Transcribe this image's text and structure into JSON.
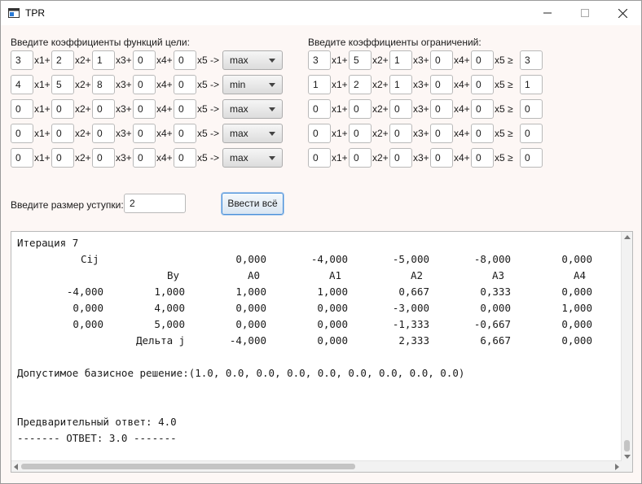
{
  "window": {
    "title": "TPR"
  },
  "goals": {
    "label": "Введите коэффициенты функций цели:",
    "var_labels": [
      "x1+",
      "x2+",
      "x3+",
      "x4+",
      "x5 ->"
    ],
    "rows": [
      {
        "coeffs": [
          "3",
          "2",
          "1",
          "0",
          "0"
        ],
        "direction": "max"
      },
      {
        "coeffs": [
          "4",
          "5",
          "8",
          "0",
          "0"
        ],
        "direction": "min"
      },
      {
        "coeffs": [
          "0",
          "0",
          "0",
          "0",
          "0"
        ],
        "direction": "max"
      },
      {
        "coeffs": [
          "0",
          "0",
          "0",
          "0",
          "0"
        ],
        "direction": "max"
      },
      {
        "coeffs": [
          "0",
          "0",
          "0",
          "0",
          "0"
        ],
        "direction": "max"
      }
    ]
  },
  "constraints": {
    "label": "Введите коэффициенты ограничений:",
    "var_labels": [
      "x1+",
      "x2+",
      "x3+",
      "x4+",
      "x5 ≥"
    ],
    "rows": [
      {
        "coeffs": [
          "3",
          "5",
          "1",
          "0",
          "0"
        ],
        "rhs": "3"
      },
      {
        "coeffs": [
          "1",
          "2",
          "1",
          "0",
          "0"
        ],
        "rhs": "1"
      },
      {
        "coeffs": [
          "0",
          "0",
          "0",
          "0",
          "0"
        ],
        "rhs": "0"
      },
      {
        "coeffs": [
          "0",
          "0",
          "0",
          "0",
          "0"
        ],
        "rhs": "0"
      },
      {
        "coeffs": [
          "0",
          "0",
          "0",
          "0",
          "0"
        ],
        "rhs": "0"
      }
    ]
  },
  "step": {
    "label": "Введите размер уступки:",
    "value": "2",
    "button": "Ввести всё"
  },
  "output": {
    "iteration": "Итерация 7",
    "cij_label": "Cij",
    "cij_values": [
      "0,000",
      "-4,000",
      "-5,000",
      "-8,000",
      "0,000"
    ],
    "by_label": "By",
    "columns": [
      "A0",
      "A1",
      "A2",
      "A3",
      "A4"
    ],
    "rows": [
      {
        "basis": "-4,000",
        "by": "1,000",
        "cells": [
          "1,000",
          "1,000",
          "0,667",
          "0,333",
          "0,000"
        ]
      },
      {
        "basis": "0,000",
        "by": "4,000",
        "cells": [
          "0,000",
          "0,000",
          "-3,000",
          "0,000",
          "1,000"
        ]
      },
      {
        "basis": "0,000",
        "by": "5,000",
        "cells": [
          "0,000",
          "0,000",
          "-1,333",
          "-0,667",
          "0,000"
        ]
      }
    ],
    "delta_label": "Дельта j",
    "delta_values": [
      "-4,000",
      "0,000",
      "2,333",
      "6,667",
      "0,000"
    ],
    "solution": "Допустимое базисное решение:(1.0, 0.0, 0.0, 0.0, 0.0, 0.0, 0.0, 0.0, 0.0)",
    "preliminary": "Предварительный ответ: 4.0",
    "answer": "------- ОТВЕТ: 3.0 -------"
  }
}
